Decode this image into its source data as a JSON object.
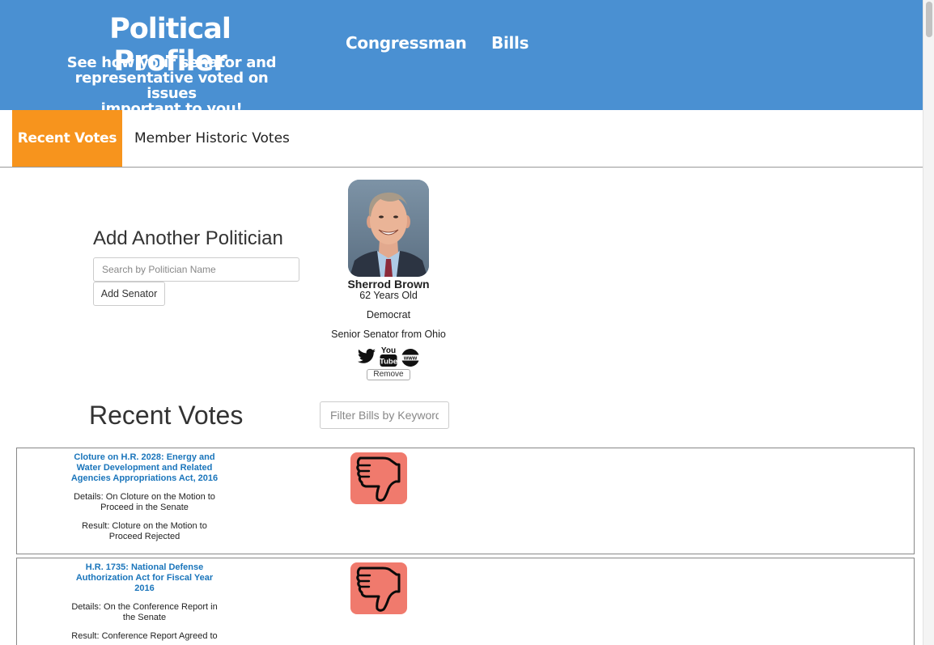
{
  "header": {
    "title": "Political Profiler",
    "subtitle_lines": [
      "See how your senator and",
      "representative voted on issues",
      "important to you!"
    ],
    "nav": [
      "Congressman",
      "Bills"
    ],
    "bg_color": "#4a90d2"
  },
  "tabs": {
    "active": "Recent Votes",
    "inactive": "Member Historic Votes",
    "active_color": "#f7941d"
  },
  "add_politician": {
    "heading": "Add Another Politician",
    "search_placeholder": "Search by Politician Name",
    "button": "Add Senator"
  },
  "politician": {
    "name": "Sherrod Brown",
    "age": "62 Years Old",
    "party": "Democrat",
    "role": "Senior Senator from Ohio",
    "social_icons": [
      "twitter-icon",
      "youtube-icon",
      "www-icon"
    ],
    "youtube_label": [
      "You",
      "Tube"
    ],
    "www_label": "www",
    "remove_label": "Remove"
  },
  "recent_votes": {
    "heading": "Recent Votes",
    "filter_placeholder": "Filter Bills by Keyword",
    "vote_color": "#f07a6d",
    "items": [
      {
        "title_lines": [
          "Cloture on H.R. 2028: Energy and",
          "Water Development and Related",
          "Agencies Appropriations Act, 2016"
        ],
        "details_lines": [
          "Details: On Cloture on the Motion to",
          "Proceed in the Senate"
        ],
        "result_lines": [
          "Result: Cloture on the Motion to",
          "Proceed Rejected"
        ],
        "vote": "thumbs-down"
      },
      {
        "title_lines": [
          "H.R. 1735: National Defense",
          "Authorization Act for Fiscal Year",
          "2016"
        ],
        "details_lines": [
          "Details: On the Conference Report in",
          "the Senate"
        ],
        "result_lines": [
          "Result: Conference Report Agreed to"
        ],
        "vote": "thumbs-down"
      }
    ]
  }
}
